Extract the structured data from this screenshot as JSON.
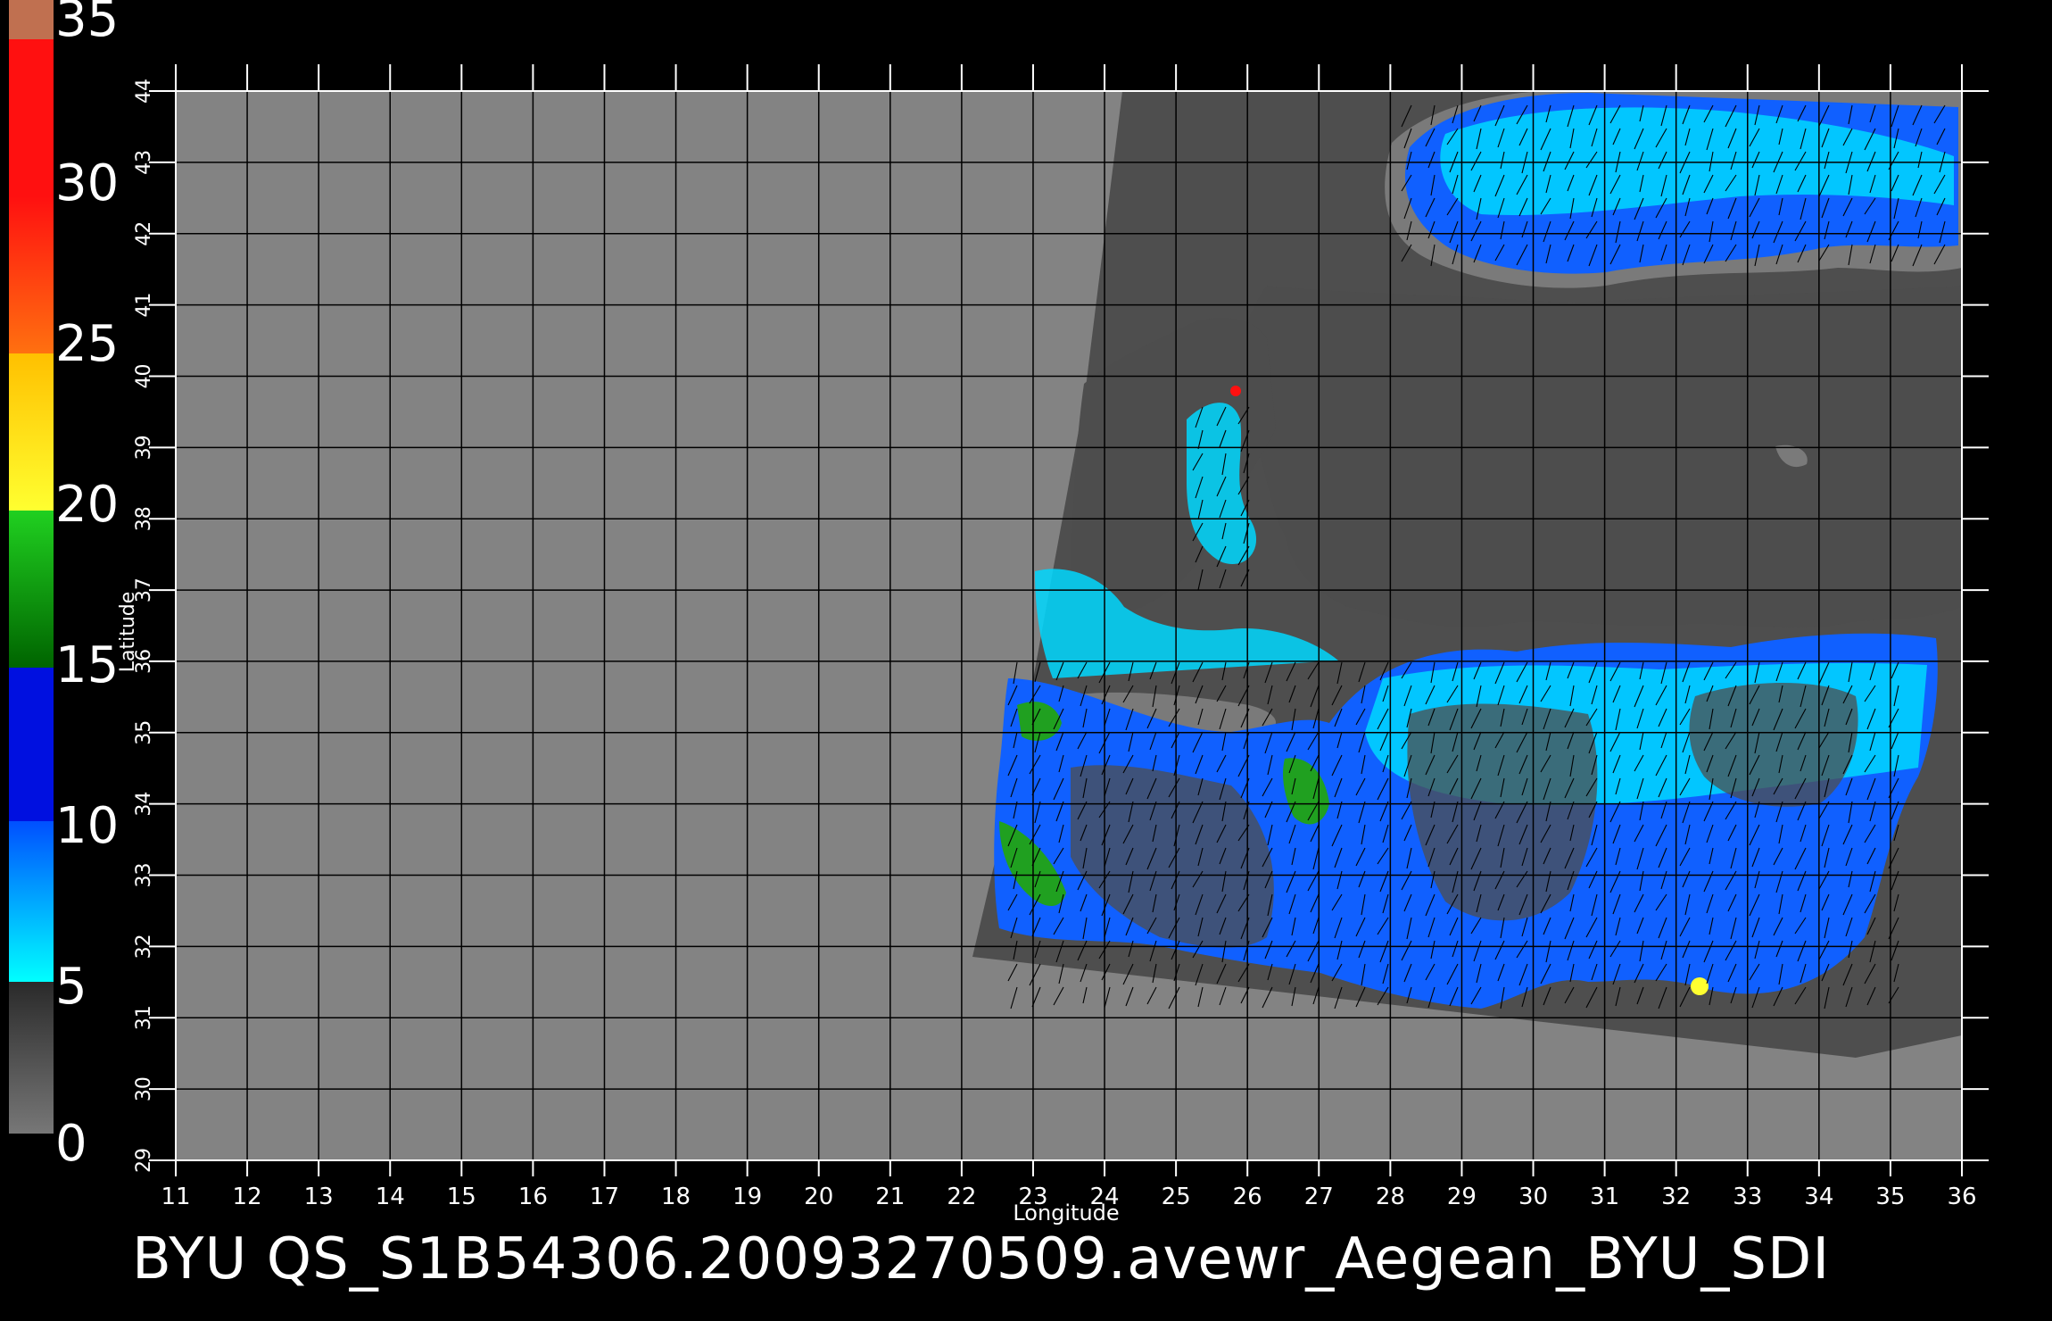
{
  "product_title": "BYU  QS_S1B54306.20093270509.avewr_Aegean_BYU_SDI",
  "x_axis": {
    "label": "Longitude",
    "ticks": [
      "11",
      "12",
      "13",
      "14",
      "15",
      "16",
      "17",
      "18",
      "19",
      "20",
      "21",
      "22",
      "23",
      "24",
      "25",
      "26",
      "27",
      "28",
      "29",
      "30",
      "31",
      "32",
      "33",
      "34",
      "35",
      "36"
    ]
  },
  "y_axis": {
    "label": "Latitude",
    "ticks": [
      "29",
      "30",
      "31",
      "32",
      "33",
      "34",
      "35",
      "36",
      "37",
      "38",
      "39",
      "40",
      "41",
      "42",
      "43",
      "44"
    ]
  },
  "colorbar": {
    "labels": [
      "0",
      "5",
      "10",
      "15",
      "20",
      "25",
      "30",
      "35"
    ],
    "colors": {
      "gray_low": "#777777",
      "gray_high": "#2a2a2a",
      "cyan": "#00ffff",
      "blue": "#0050ff",
      "deep_blue": "#0010e0",
      "dark_green": "#006400",
      "green": "#20d020",
      "yellow": "#ffff30",
      "orange_yellow": "#ffc000",
      "orange": "#ff7010",
      "red": "#ff1010",
      "brown": "#c07050"
    }
  },
  "map_colors": {
    "no_data_gray": "#838383",
    "swath_dark": "#4e4e4e",
    "land_dark": "#4d4d4d",
    "coast_gray": "#7a7a7a",
    "wind_cyan": "#00d8ff",
    "wind_blue": "#1060ff",
    "wind_green": "#20a020",
    "grid_lines": "#000000",
    "axis_white": "#ffffff"
  }
}
